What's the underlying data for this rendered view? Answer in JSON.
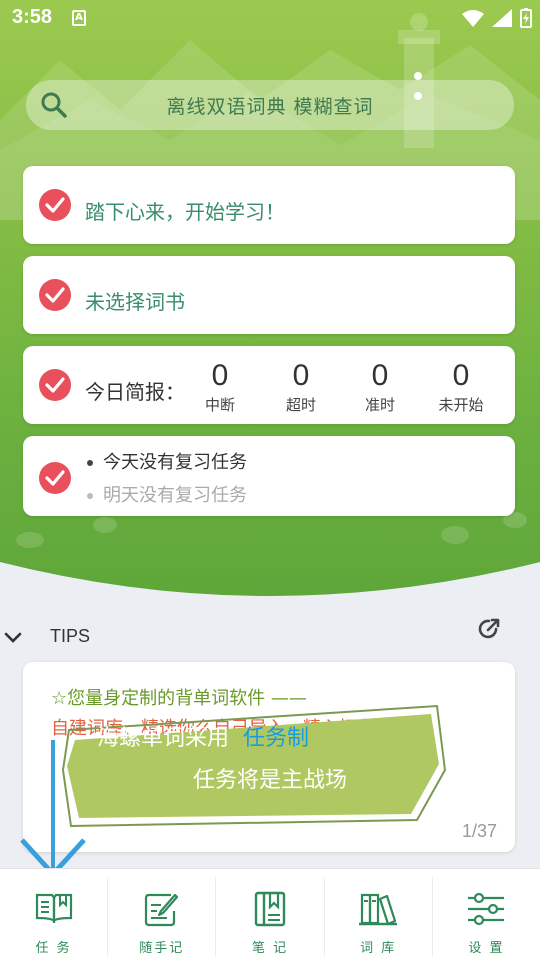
{
  "status": {
    "time": "3:58",
    "indicator": "A"
  },
  "search": {
    "placeholder": "离线双语词典 模糊查词"
  },
  "cards": {
    "start": {
      "text": "踏下心来，开始学习！"
    },
    "book": {
      "text": "未选择词书"
    },
    "report": {
      "label": "今日简报：",
      "stats": [
        {
          "value": "0",
          "label": "中断"
        },
        {
          "value": "0",
          "label": "超时"
        },
        {
          "value": "0",
          "label": "准时"
        },
        {
          "value": "0",
          "label": "未开始"
        }
      ]
    },
    "review": {
      "today": "今天没有复习任务",
      "tomorrow": "明天没有复习任务"
    }
  },
  "tips": {
    "title": "TIPS",
    "line1": "☆您量身定制的背单词软件 ——",
    "line2": "自建词库、精选你么自己导入、精心拥有。",
    "banner_main": "海螺单词采用",
    "banner_highlight": "任务制",
    "banner_sub": "任务将是主战场",
    "pager": "1/37"
  },
  "nav": [
    {
      "label": "任 务",
      "icon": "book-open-icon"
    },
    {
      "label": "随手记",
      "icon": "pencil-note-icon"
    },
    {
      "label": "笔 记",
      "icon": "notebook-icon"
    },
    {
      "label": "词 库",
      "icon": "library-books-icon"
    },
    {
      "label": "设 置",
      "icon": "sliders-icon"
    }
  ],
  "colors": {
    "accent_green": "#2f8a5a",
    "check_red": "#e8505b",
    "highlight_blue": "#1a9be0"
  }
}
